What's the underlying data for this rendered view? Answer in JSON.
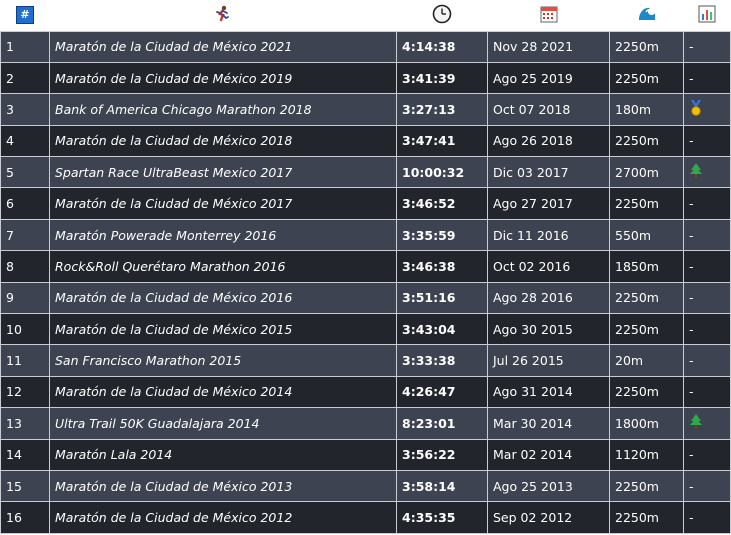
{
  "header": {
    "num_icon_text": "#",
    "columns": [
      {
        "key": "num",
        "icon": "hash-icon"
      },
      {
        "key": "race",
        "icon": "runner-icon"
      },
      {
        "key": "time",
        "icon": "stopwatch-icon"
      },
      {
        "key": "date",
        "icon": "calendar-icon"
      },
      {
        "key": "elevation",
        "icon": "wave-icon"
      },
      {
        "key": "badge",
        "icon": "bar-chart-icon"
      }
    ]
  },
  "rows": [
    {
      "num": "1",
      "race": "Maratón de la Ciudad de México 2021",
      "time": "4:14:38",
      "date": "Nov 28 2021",
      "elevation": "2250m",
      "badge": "-"
    },
    {
      "num": "2",
      "race": "Maratón de la Ciudad de México 2019",
      "time": "3:41:39",
      "date": "Ago 25 2019",
      "elevation": "2250m",
      "badge": "-"
    },
    {
      "num": "3",
      "race": "Bank of America Chicago Marathon 2018",
      "time": "3:27:13",
      "date": "Oct 07 2018",
      "elevation": "180m",
      "badge": "medal-icon"
    },
    {
      "num": "4",
      "race": "Maratón de la Ciudad de México 2018",
      "time": "3:47:41",
      "date": "Ago 26 2018",
      "elevation": "2250m",
      "badge": "-"
    },
    {
      "num": "5",
      "race": "Spartan Race UltraBeast Mexico 2017",
      "time": "10:00:32",
      "date": "Dic 03 2017",
      "elevation": "2700m",
      "badge": "tree-icon"
    },
    {
      "num": "6",
      "race": "Maratón de la Ciudad de México 2017",
      "time": "3:46:52",
      "date": "Ago 27 2017",
      "elevation": "2250m",
      "badge": "-"
    },
    {
      "num": "7",
      "race": "Maratón Powerade Monterrey 2016",
      "time": "3:35:59",
      "date": "Dic 11 2016",
      "elevation": "550m",
      "badge": "-"
    },
    {
      "num": "8",
      "race": "Rock&Roll Querétaro Marathon 2016",
      "time": "3:46:38",
      "date": "Oct 02 2016",
      "elevation": "1850m",
      "badge": "-"
    },
    {
      "num": "9",
      "race": "Maratón de la Ciudad de México 2016",
      "time": "3:51:16",
      "date": "Ago 28 2016",
      "elevation": "2250m",
      "badge": "-"
    },
    {
      "num": "10",
      "race": "Maratón de la Ciudad de México 2015",
      "time": "3:43:04",
      "date": "Ago 30 2015",
      "elevation": "2250m",
      "badge": "-"
    },
    {
      "num": "11",
      "race": "San Francisco Marathon 2015",
      "time": "3:33:38",
      "date": "Jul 26 2015",
      "elevation": "20m",
      "badge": "-"
    },
    {
      "num": "12",
      "race": "Maratón de la Ciudad de México 2014",
      "time": "4:26:47",
      "date": "Ago 31 2014",
      "elevation": "2250m",
      "badge": "-"
    },
    {
      "num": "13",
      "race": "Ultra Trail 50K Guadalajara 2014",
      "time": "8:23:01",
      "date": "Mar 30 2014",
      "elevation": "1800m",
      "badge": "tree-icon"
    },
    {
      "num": "14",
      "race": "Maratón Lala 2014",
      "time": "3:56:22",
      "date": "Mar 02 2014",
      "elevation": "1120m",
      "badge": "-"
    },
    {
      "num": "15",
      "race": "Maratón de la Ciudad de México 2013",
      "time": "3:58:14",
      "date": "Ago 25 2013",
      "elevation": "2250m",
      "badge": "-"
    },
    {
      "num": "16",
      "race": "Maratón de la Ciudad de México 2012",
      "time": "4:35:35",
      "date": "Sep 02 2012",
      "elevation": "2250m",
      "badge": "-"
    }
  ]
}
